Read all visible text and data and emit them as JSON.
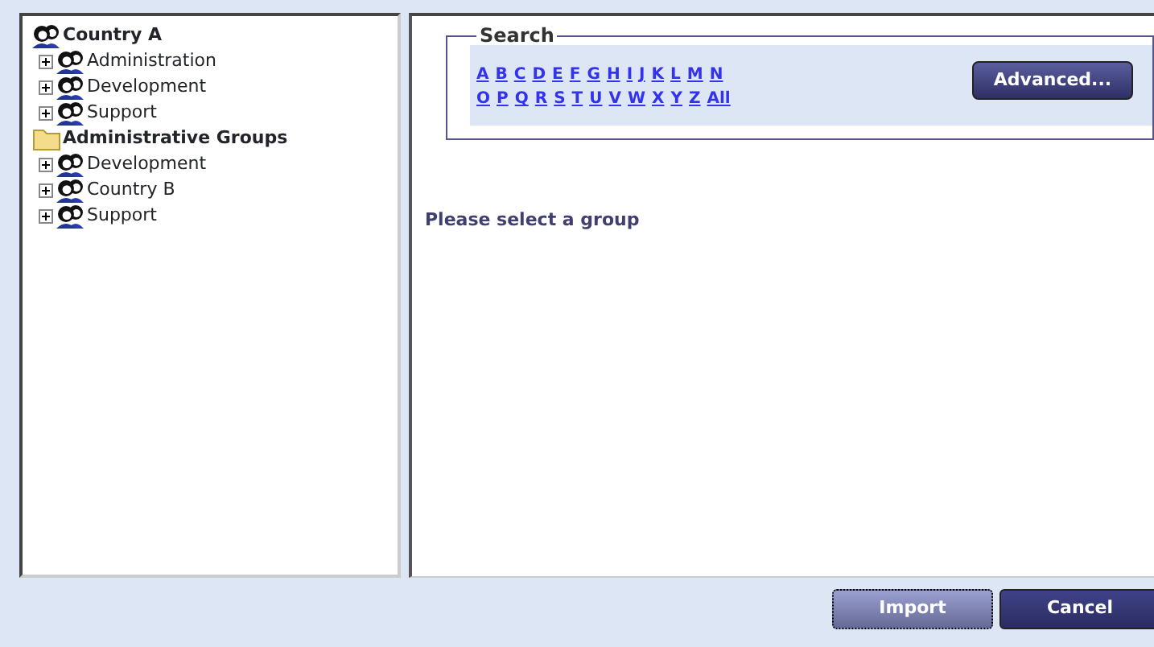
{
  "tree": [
    {
      "label": "Country A",
      "kind": "group",
      "children": [
        {
          "label": "Administration",
          "kind": "group",
          "expandable": true
        },
        {
          "label": "Development",
          "kind": "group",
          "expandable": true
        },
        {
          "label": "Support",
          "kind": "group",
          "expandable": true
        }
      ]
    },
    {
      "label": "Administrative Groups",
      "kind": "folder",
      "children": [
        {
          "label": "Development",
          "kind": "group",
          "expandable": true
        },
        {
          "label": "Country B",
          "kind": "group",
          "expandable": true
        },
        {
          "label": "Support",
          "kind": "group",
          "expandable": true
        }
      ]
    }
  ],
  "search": {
    "title": "Search",
    "letter_rows": [
      [
        "A",
        "B",
        "C",
        "D",
        "E",
        "F",
        "G",
        "H",
        "I",
        "J",
        "K",
        "L",
        "M",
        "N"
      ],
      [
        "O",
        "P",
        "Q",
        "R",
        "S",
        "T",
        "U",
        "V",
        "W",
        "X",
        "Y",
        "Z",
        "All"
      ]
    ],
    "advanced_button": "Advanced..."
  },
  "message": "Please select a group",
  "buttons": [
    {
      "label": "Import",
      "disabled": true,
      "focused": true
    },
    {
      "label": "Cancel",
      "disabled": false,
      "focused": false
    }
  ]
}
